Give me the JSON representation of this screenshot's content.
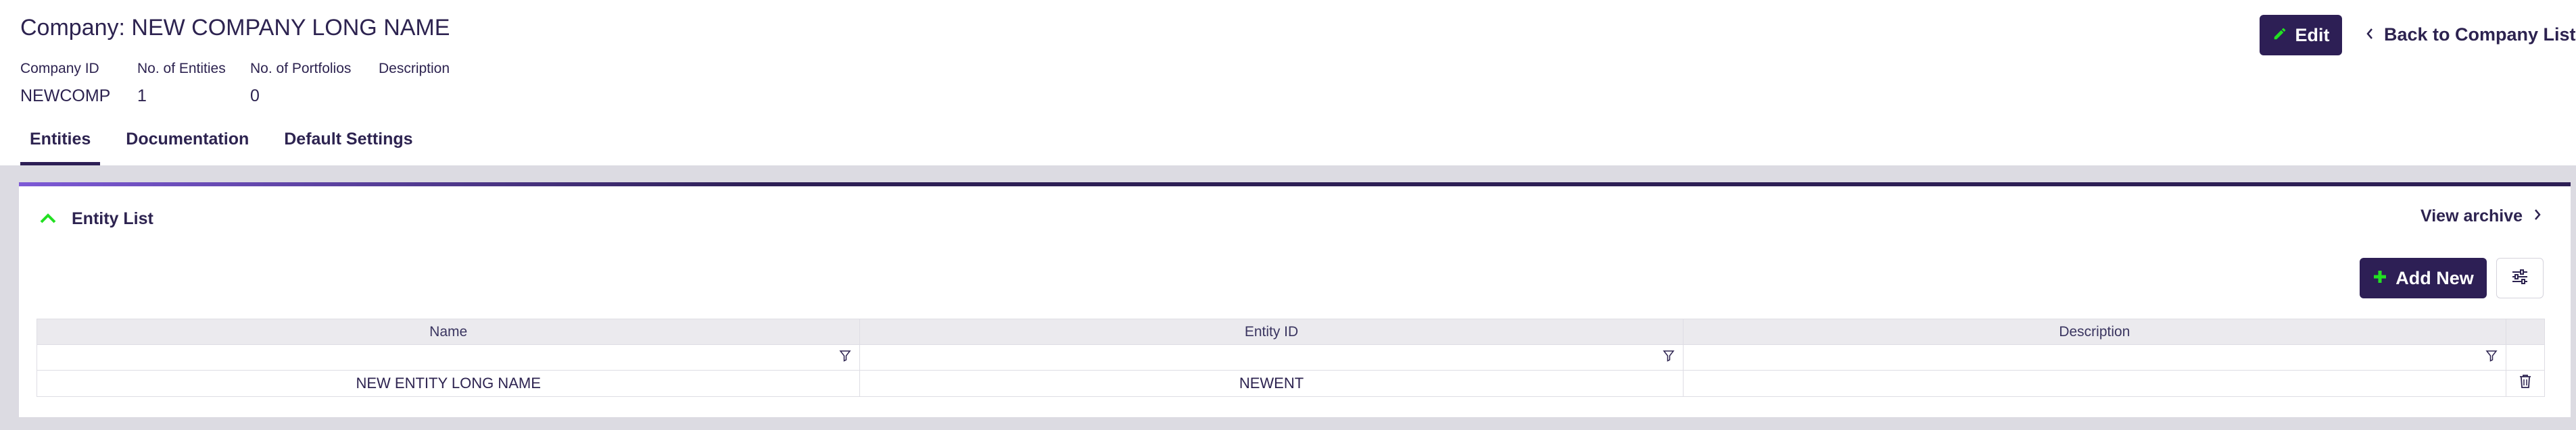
{
  "header": {
    "title": "Company: NEW COMPANY LONG NAME",
    "edit_label": "Edit",
    "back_label": "Back to Company List"
  },
  "meta": [
    {
      "label": "Company ID",
      "value": "NEWCOMP"
    },
    {
      "label": "No. of Entities",
      "value": "1"
    },
    {
      "label": "No. of Portfolios",
      "value": "0"
    },
    {
      "label": "Description",
      "value": ""
    }
  ],
  "tabs": [
    {
      "label": "Entities",
      "active": true
    },
    {
      "label": "Documentation",
      "active": false
    },
    {
      "label": "Default Settings",
      "active": false
    }
  ],
  "entity_panel": {
    "title": "Entity List",
    "view_archive_label": "View archive",
    "add_label": "Add New",
    "columns": [
      "Name",
      "Entity ID",
      "Description"
    ],
    "rows": [
      {
        "name": "NEW ENTITY LONG NAME",
        "entity_id": "NEWENT",
        "description": ""
      }
    ]
  },
  "colors": {
    "primary": "#2d1f55",
    "accent_green": "#22e022",
    "background_gray": "#dcdbe2"
  }
}
